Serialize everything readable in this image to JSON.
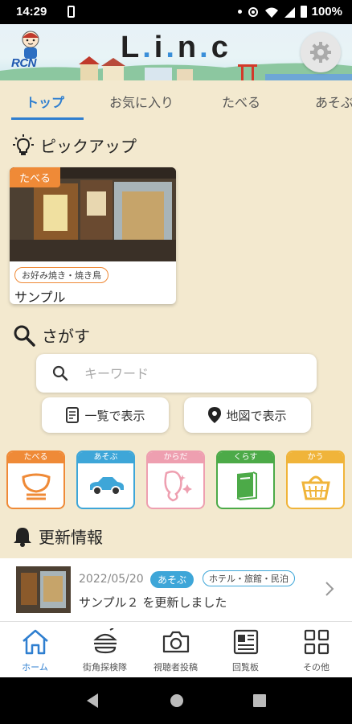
{
  "status_bar": {
    "time": "14:29",
    "battery": "100%"
  },
  "header": {
    "brand": "RCN",
    "logo_parts": [
      "L",
      ".",
      "i",
      ".",
      "n",
      ".",
      "c"
    ]
  },
  "tabs": [
    {
      "label": "トップ",
      "active": true
    },
    {
      "label": "お気に入り",
      "active": false
    },
    {
      "label": "たべる",
      "active": false
    },
    {
      "label": "あそぶ",
      "active": false
    }
  ],
  "pickup": {
    "title": "ピックアップ",
    "card": {
      "badge": "たべる",
      "tag": "お好み焼き・焼き鳥",
      "name": "サンプル"
    }
  },
  "search": {
    "title": "さがす",
    "placeholder": "キーワード",
    "list_button": "一覧で表示",
    "map_button": "地図で表示"
  },
  "categories": [
    {
      "label": "たべる",
      "color": "#ef8a37",
      "icon": "bowl-icon"
    },
    {
      "label": "あそぶ",
      "color": "#3ea6d8",
      "icon": "car-icon"
    },
    {
      "label": "からだ",
      "color": "#ee9fb0",
      "icon": "beauty-icon"
    },
    {
      "label": "くらす",
      "color": "#4caa48",
      "icon": "book-icon"
    },
    {
      "label": "かう",
      "color": "#f0b43a",
      "icon": "basket-icon"
    }
  ],
  "updates": {
    "title": "更新情報",
    "item": {
      "date": "2022/05/20",
      "category": "あそぶ",
      "tag": "ホテル・旅館・民泊",
      "text": "サンプル２ を更新しました"
    }
  },
  "bottom_nav": [
    {
      "label": "ホーム",
      "icon": "home-icon",
      "active": true
    },
    {
      "label": "街角探検隊",
      "icon": "burger-icon",
      "active": false
    },
    {
      "label": "視聴者投稿",
      "icon": "camera-icon",
      "active": false
    },
    {
      "label": "回覧板",
      "icon": "newspaper-icon",
      "active": false
    },
    {
      "label": "その他",
      "icon": "grid-icon",
      "active": false
    }
  ],
  "colors": {
    "accent": "#2f7fd0",
    "background": "#f3e9cf",
    "tabe": "#ef8a37",
    "asobu": "#3ea6d8"
  }
}
